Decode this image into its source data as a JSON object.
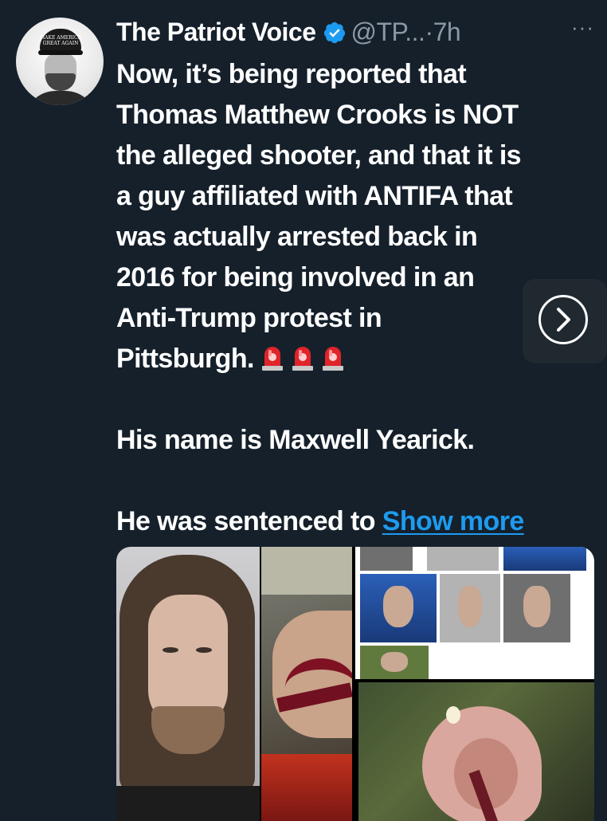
{
  "author": {
    "display_name": "The Patriot Voice",
    "handle": "@TP...",
    "separator": "·",
    "timestamp": "7h",
    "more_label": "···",
    "avatar_cap_text": "MAKE AMERICA GREAT AGAIN",
    "verified_color": "#1d9bf0"
  },
  "tweet": {
    "lines": [
      "Now, it’s being reported that",
      "Thomas Matthew Crooks is NOT",
      "the alleged shooter, and that it is",
      "a guy affiliated with ANTIFA that",
      "was actually arrested back in",
      "2016 for being involved in an",
      "Anti-Trump protest in",
      "Pittsburgh."
    ],
    "sirens": [
      "🚨",
      "🚨",
      "🚨"
    ],
    "paragraph2": "His name is Maxwell Yearick.",
    "paragraph3": "He was sentenced to",
    "show_more": "Show more",
    "link_color": "#1d9bf0"
  },
  "media": {
    "items": [
      "mugshot-photo",
      "injured-man-photo",
      "news-collage-photo",
      "ear-closeup-photo"
    ]
  },
  "colors": {
    "background": "#15202b",
    "text": "#ffffff",
    "secondary_text": "#8b98a5"
  }
}
